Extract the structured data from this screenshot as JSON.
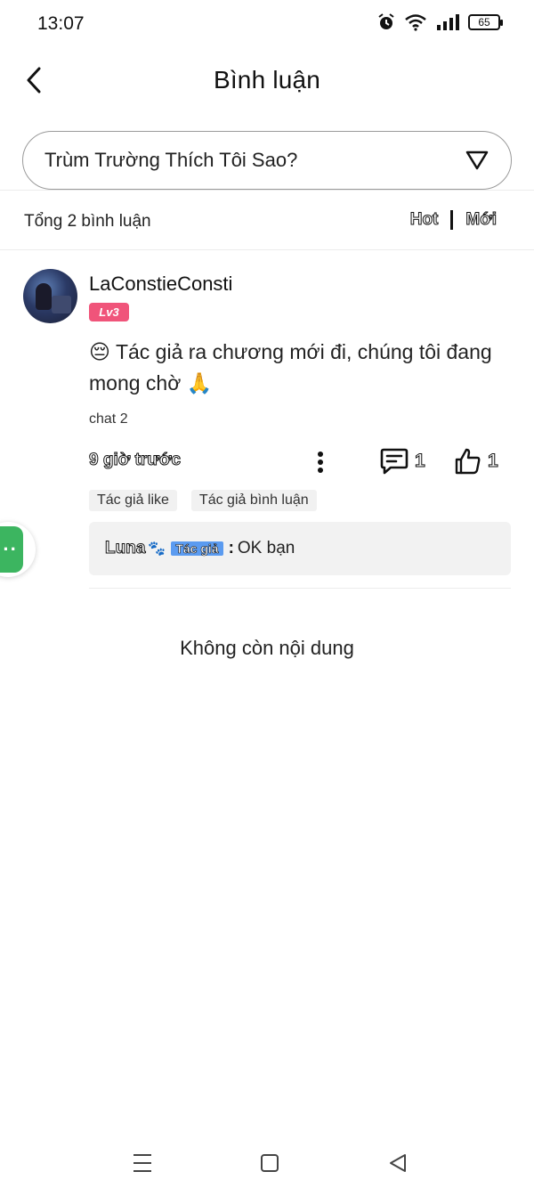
{
  "status_bar": {
    "time": "13:07",
    "battery": "65"
  },
  "header": {
    "title": "Bình luận"
  },
  "story_selector": {
    "label": "Trùm Trường Thích Tôi Sao?"
  },
  "summary": {
    "total": "Tổng 2 bình luận",
    "sort_hot": "Hot",
    "sort_new": "Mới"
  },
  "comment": {
    "username": "LaConstieConsti",
    "level": "Lv3",
    "text": "😔 Tác giả ra chương mới đi, chúng tôi đang mong chờ 🙏",
    "chapter": "chat 2",
    "time": "9 giờ trước",
    "reply_count": "1",
    "like_count": "1",
    "tags": [
      "Tác giả like",
      "Tác giả bình luận"
    ],
    "reply": {
      "user": "Luna",
      "badge": "Tác giả",
      "text": "OK bạn"
    }
  },
  "footer": {
    "end_text": "Không còn nội dung"
  }
}
